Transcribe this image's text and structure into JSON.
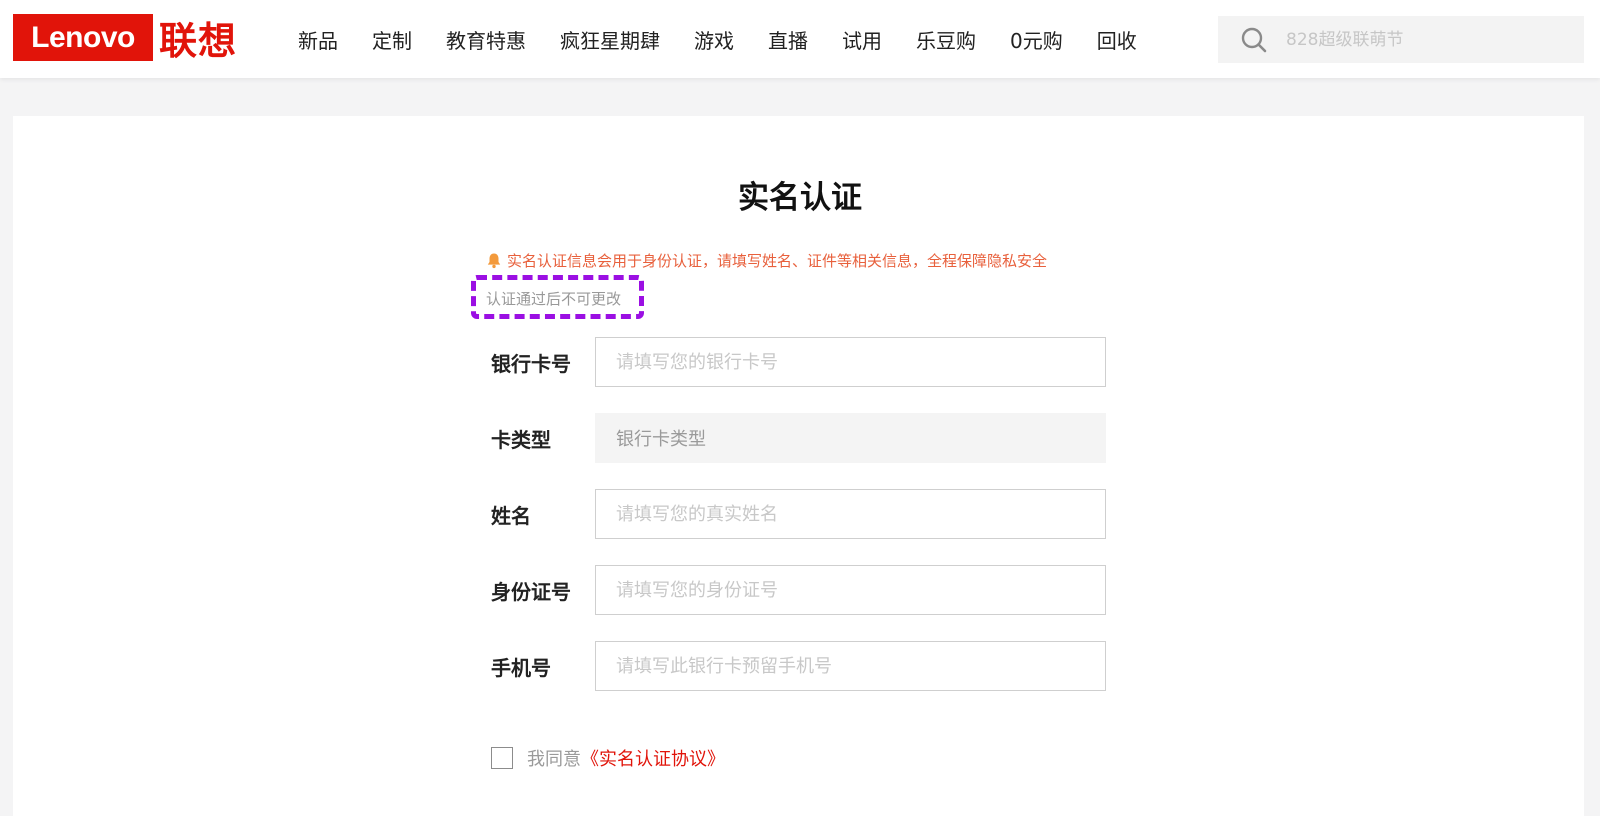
{
  "header": {
    "logo_en": "Lenovo",
    "logo_cn": "联想",
    "nav": [
      "新品",
      "定制",
      "教育特惠",
      "疯狂星期肆",
      "游戏",
      "直播",
      "试用",
      "乐豆购",
      "0元购",
      "回收"
    ],
    "search_placeholder": "828超级联萌节"
  },
  "page": {
    "title": "实名认证",
    "notice": "实名认证信息会用于身份认证，请填写姓名、证件等相关信息，全程保障隐私安全",
    "subnote": "认证通过后不可更改"
  },
  "form": {
    "bank_card": {
      "label": "银行卡号",
      "placeholder": "请填写您的银行卡号"
    },
    "card_type": {
      "label": "卡类型",
      "value": "银行卡类型"
    },
    "name": {
      "label": "姓名",
      "placeholder": "请填写您的真实姓名"
    },
    "id_number": {
      "label": "身份证号",
      "placeholder": "请填写您的身份证号"
    },
    "phone": {
      "label": "手机号",
      "placeholder": "请填写此银行卡预留手机号"
    }
  },
  "agreement": {
    "text": "我同意",
    "link": "《实名认证协议》"
  },
  "colors": {
    "brand": "#e1140a",
    "notice": "#e8603c",
    "highlight": "#9b0fe3"
  },
  "icons": {
    "search": "search-icon",
    "notice": "bell-icon"
  }
}
